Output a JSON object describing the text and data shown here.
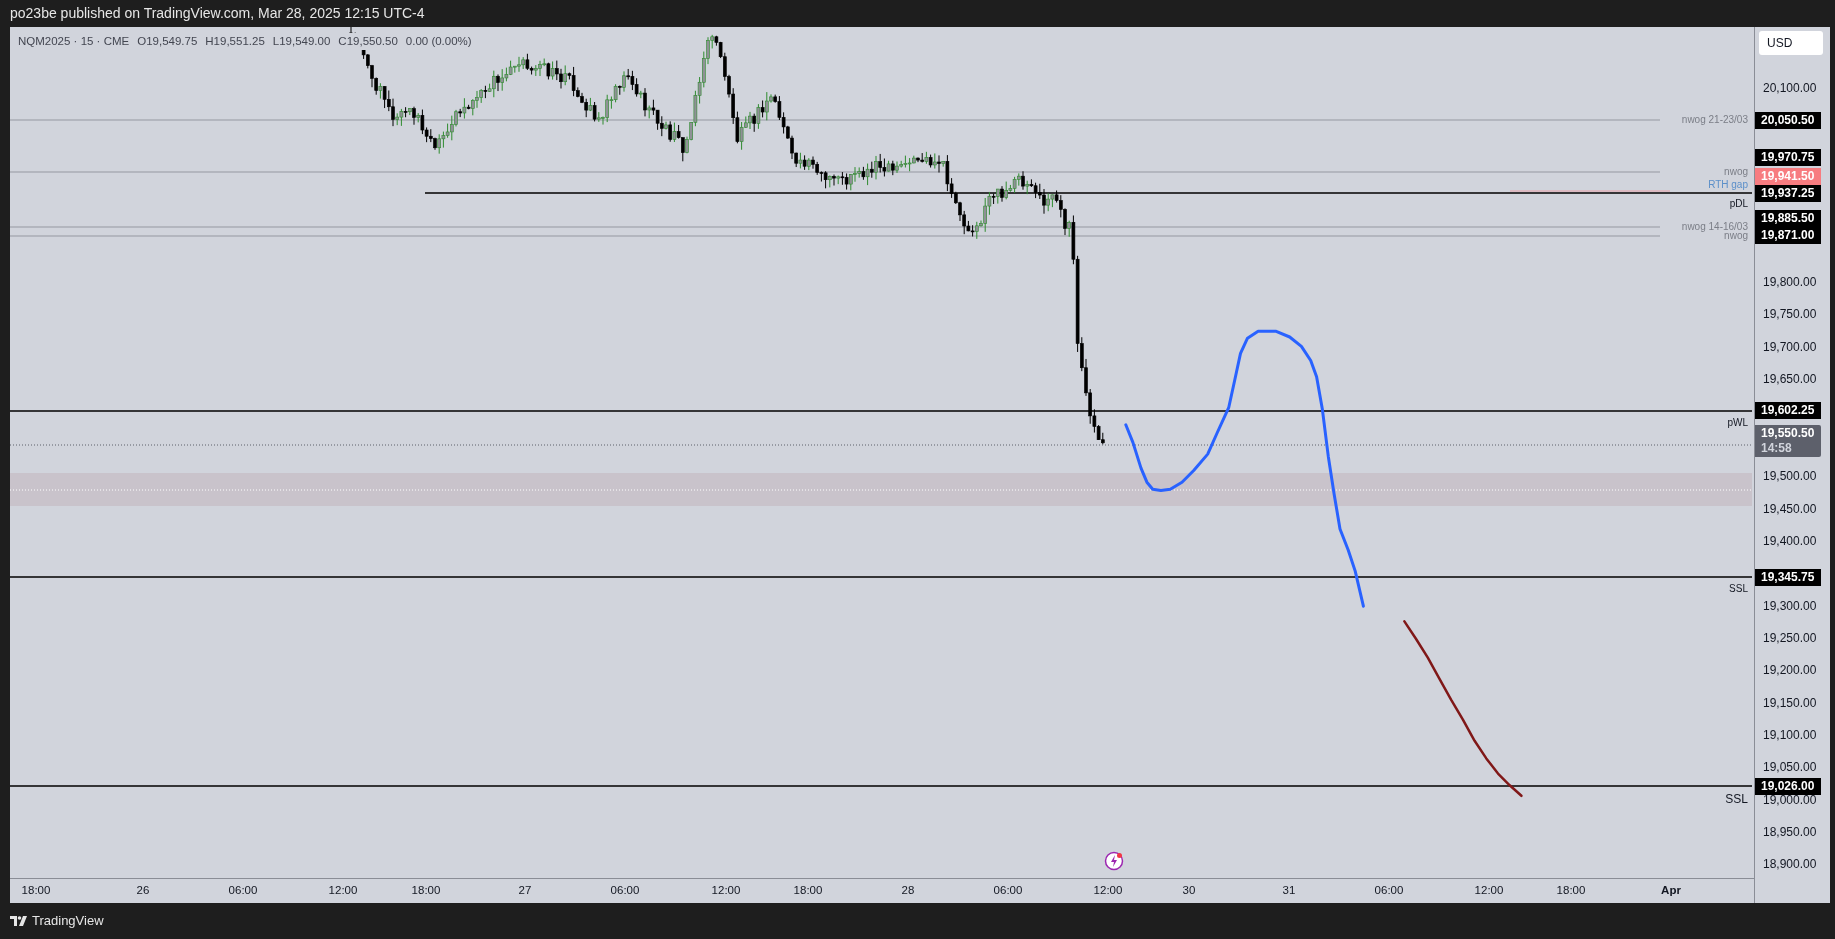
{
  "header": {
    "title": "po23be published on TradingView.com, Mar 28, 2025 12:15 UTC-4"
  },
  "legend": {
    "symbol": "NQM2025 · 15 · CME",
    "values": [
      "O19,549.75",
      "H19,551.25",
      "L19,549.00",
      "C19,550.50",
      "0.00 (0.00%)"
    ]
  },
  "lines": [
    {
      "label": "nwog 21-23/03",
      "kind": "gray"
    },
    {
      "label": "nwog",
      "kind": "gray"
    },
    {
      "label": "RTH gap",
      "kind": "pink"
    },
    {
      "label": "pDL",
      "kind": "black"
    },
    {
      "label": "nwog 14-16/03",
      "kind": "gray"
    },
    {
      "label": "nwog",
      "kind": "gray"
    },
    {
      "label": "pWL",
      "kind": "black"
    },
    {
      "label": "SSL",
      "kind": "black"
    },
    {
      "label": "SSL",
      "kind": "black"
    }
  ],
  "price_axis": {
    "currency": "USD",
    "ticks": [
      "20,100.00",
      "19,800.00",
      "19,750.00",
      "19,700.00",
      "19,650.00",
      "19,500.00",
      "19,450.00",
      "19,400.00",
      "19,300.00",
      "19,250.00",
      "19,200.00",
      "19,150.00",
      "19,100.00",
      "19,050.00",
      "19,000.00",
      "18,950.00",
      "18,900.00"
    ],
    "price_tags": [
      {
        "text": "20,050.50",
        "color": "#000000"
      },
      {
        "text": "19,970.75",
        "color": "#000000"
      },
      {
        "text": "19,941.50",
        "color": "#f77c80"
      },
      {
        "text": "19,937.25",
        "color": "#000000"
      },
      {
        "text": "19,885.50",
        "color": "#000000"
      },
      {
        "text": "19,871.00",
        "color": "#000000"
      },
      {
        "text": "19,602.25",
        "color": "#000000"
      },
      {
        "text": "19,345.75",
        "color": "#000000"
      },
      {
        "text": "19,026.00",
        "color": "#000000"
      }
    ],
    "current_price": {
      "price": "19,550.50",
      "countdown": "14:58"
    }
  },
  "time_axis": [
    "18:00",
    "26",
    "06:00",
    "12:00",
    "18:00",
    "27",
    "06:00",
    "12:00",
    "18:00",
    "28",
    "06:00",
    "12:00",
    "30",
    "31",
    "06:00",
    "12:00",
    "18:00",
    "Apr"
  ],
  "footer": {
    "brand": "TradingView"
  }
}
